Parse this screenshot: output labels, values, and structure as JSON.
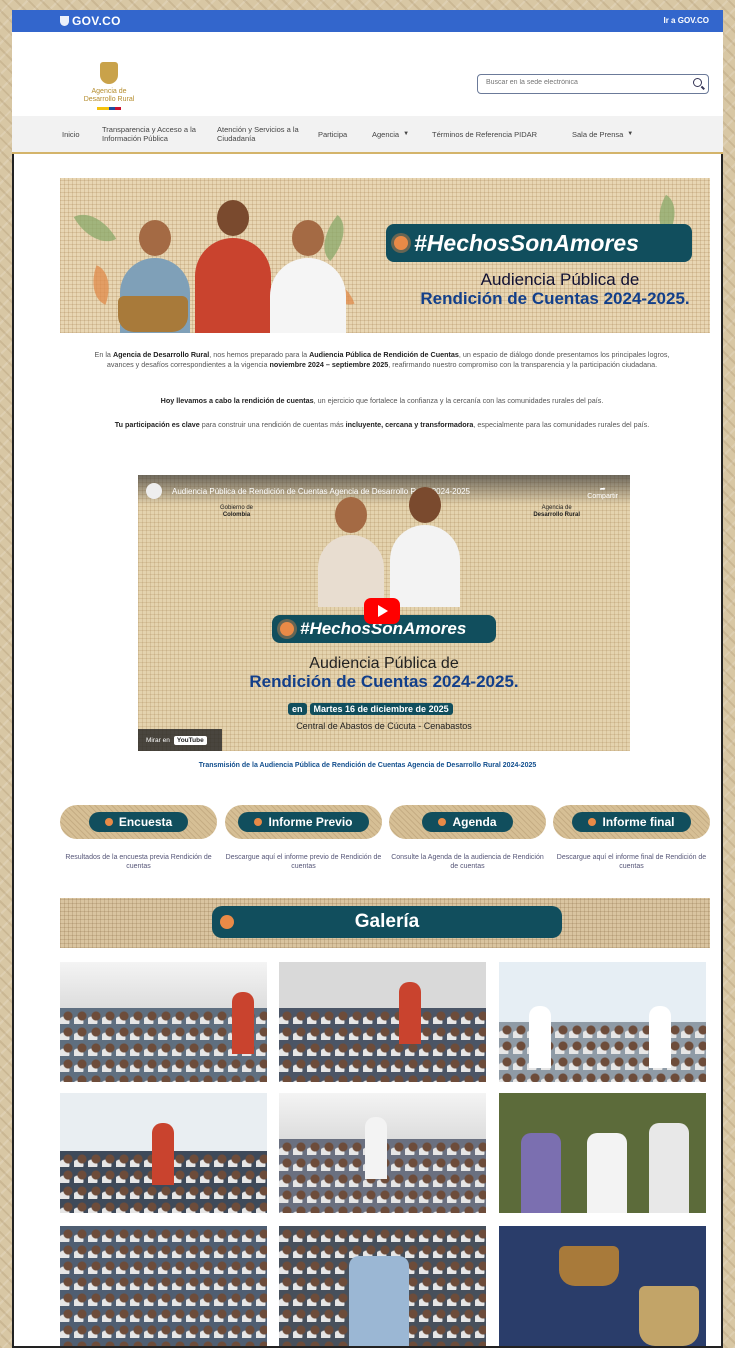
{
  "gov_bar": {
    "logo": "GOV.CO",
    "link": "Ir a GOV.CO"
  },
  "brand": {
    "line1": "Agencia de",
    "line2": "Desarrollo Rural"
  },
  "search": {
    "placeholder": "Buscar en la sede electrónica"
  },
  "nav": {
    "items": [
      {
        "label": "Inicio"
      },
      {
        "label": "Transparencia y Acceso a la Información Pública"
      },
      {
        "label": "Atención y Servicios a la Ciudadanía"
      },
      {
        "label": "Participa"
      },
      {
        "label": "Agencia",
        "caret": "▼"
      },
      {
        "label": "Términos de Referencia PIDAR"
      },
      {
        "label": "Sala de Prensa",
        "caret": "▼"
      }
    ]
  },
  "banner": {
    "hashtag": "#HechosSonAmores",
    "line1": "Audiencia Pública de",
    "line2": "Rendición de Cuentas 2024-2025."
  },
  "intro": {
    "p1_a": "En la ",
    "p1_b": "Agencia de Desarrollo Rural",
    "p1_c": ", nos hemos preparado para la ",
    "p1_d": "Audiencia Pública de Rendición de Cuentas",
    "p1_e": ", un espacio de diálogo donde presentamos los principales logros, avances y desafíos correspondientes a la vigencia ",
    "p1_f": "noviembre 2024 – septiembre 2025",
    "p1_g": ", reafirmando nuestro compromiso con la transparencia y la participación ciudadana.",
    "p2_a": "Hoy llevamos a cabo la rendición de cuentas",
    "p2_b": ", un ejercicio que fortalece la confianza y la cercanía con las comunidades rurales del país.",
    "p3_a": "Tu participación es clave",
    "p3_b": " para construir una rendición de cuentas más ",
    "p3_c": "incluyente, cercana y transformadora",
    "p3_d": ", especialmente para las comunidades rurales del país."
  },
  "video": {
    "title": "Audiencia Pública de Rendición de Cuentas Agencia de Desarrollo Rural 2024-2025",
    "share": "Compartir",
    "gov_label_1": "Gobierno de",
    "gov_label_2": "Colombia",
    "adr_label_1": "Agencia de",
    "adr_label_2": "Desarrollo Rural",
    "hashtag": "#HechosSonAmores",
    "line1": "Audiencia Pública de",
    "line2": "Rendición de Cuentas 2024-2025.",
    "date_prefix": "en",
    "date": "Martes 16 de diciembre de 2025",
    "place": "Central de Abastos de Cúcuta - Cenabastos",
    "watch_on": "Mirar en",
    "youtube": "YouTube"
  },
  "caption": "Transmisión de la Audiencia Pública de Rendición de Cuentas Agencia de Desarrollo Rural 2024-2025",
  "cards": [
    {
      "label": "Encuesta",
      "desc": "Resultados de la encuesta previa Rendición de cuentas"
    },
    {
      "label": "Informe Previo",
      "desc": "Descargue aquí el informe previo de Rendición de cuentas"
    },
    {
      "label": "Agenda",
      "desc": "Consulte la Agenda de la audiencia de Rendición de cuentas"
    },
    {
      "label": "Informe final",
      "desc": "Descargue aquí el informe final de Rendición de cuentas"
    }
  ],
  "gallery": {
    "title": "Galería"
  },
  "colors": {
    "gov_blue": "#3366cc",
    "teal": "#114e5d",
    "accent_orange": "#e98a47",
    "title_blue": "#123f8a",
    "gold": "#d4b46a"
  }
}
